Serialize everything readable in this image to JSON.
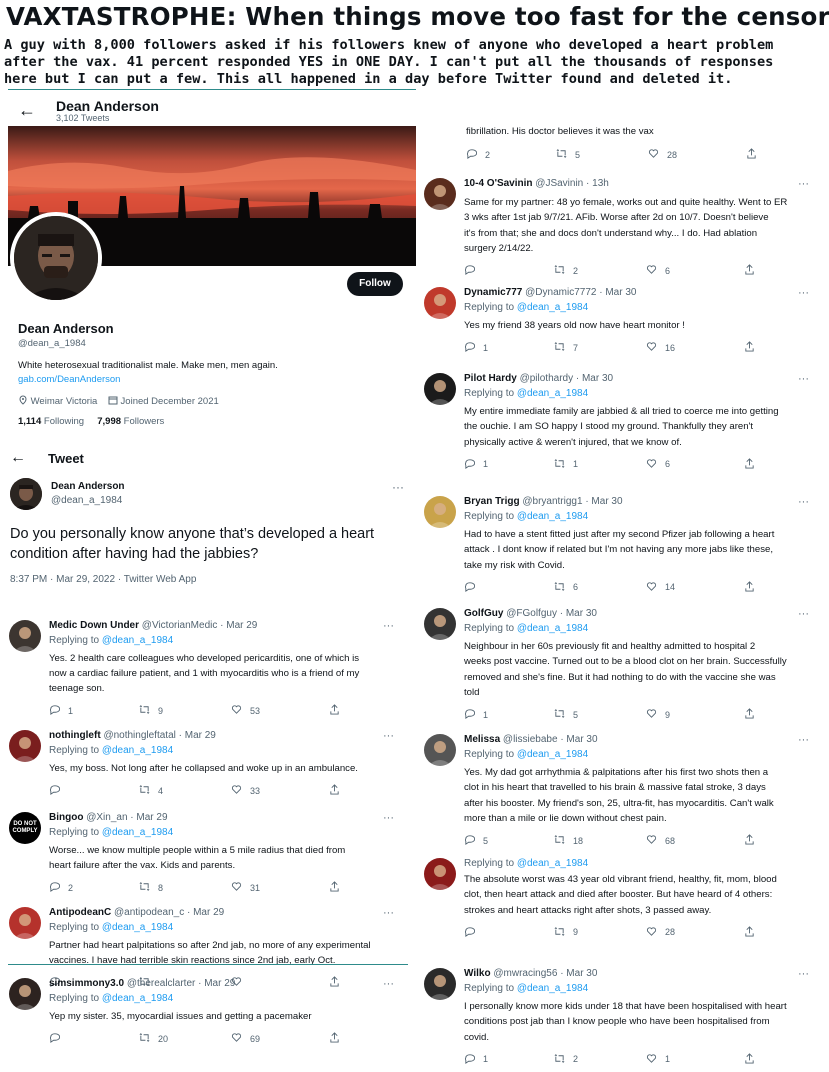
{
  "headline": "VAXTASTROPHE:  When things move too fast for the censors.",
  "subhead": [
    "A guy with 8,000 followers asked if his followers knew of anyone who developed a heart problem",
    "after the vax.  41 percent responded YES in ONE DAY.  I can't put all the thousands of responses",
    "here but I can put a few. This all happened in a day before Twitter found and deleted it."
  ],
  "profile": {
    "name": "Dean Anderson",
    "tweets": "3,102 Tweets",
    "follow_label": "Follow",
    "handle": "@dean_a_1984",
    "bio": "White heterosexual traditionalist male. Make men, men again.",
    "link": "gab.com/DeanAnderson",
    "location": "Weimar Victoria",
    "joined": "Joined December 2021",
    "following_count": "1,114",
    "following_label": "Following",
    "followers_count": "7,998",
    "followers_label": "Followers"
  },
  "tweet": {
    "title": "Tweet",
    "name": "Dean Anderson",
    "handle": "@dean_a_1984",
    "text": "Do you personally know anyone that’s developed a heart condition after having had the jabbies?",
    "time": "8:37 PM · Mar 29, 2022 · Twitter Web App"
  },
  "replying_prefix": "Replying to",
  "reply_target": "@dean_a_1984",
  "left_replies": [
    {
      "name": "Medic Down Under",
      "sub": "@VictorianMedic · Mar 29",
      "lines": [
        "Yes. 2 health care colleagues who developed pericarditis, one of which is",
        "now a cardiac failure patient, and 1 with myocarditis who is a friend of my",
        "teenage son."
      ],
      "reply": "1",
      "retweet": "9",
      "like": "53"
    },
    {
      "name": "nothingleft",
      "sub": "@nothingleftatal · Mar 29",
      "lines": [
        "Yes, my boss. Not long after he collapsed and woke up in an ambulance."
      ],
      "reply": "",
      "retweet": "4",
      "like": "33"
    },
    {
      "name": "Bingoo",
      "sub": "@Xin_an · Mar 29",
      "avatar_text": "DO NOT COMPLY",
      "lines": [
        "Worse... we know multiple people within a 5 mile radius that died from",
        "heart failure after the vax.  Kids and parents."
      ],
      "reply": "2",
      "retweet": "8",
      "like": "31"
    },
    {
      "name": "AntipodeanC",
      "sub": "@antipodean_c · Mar 29",
      "lines": [
        "Partner had heart palpitations so after 2nd jab, no more of any experimental",
        "vaccines. I have had terrible skin reactions since 2nd jab, early Oct."
      ],
      "reply": "",
      "retweet": "",
      "like": ""
    },
    {
      "name": "simsimmony3.0",
      "sub": "@therealclarter · Mar 29",
      "lines": [
        "Yep my sister. 35, myocardial issues and getting a pacemaker"
      ],
      "reply": "",
      "retweet": "20",
      "like": "69"
    }
  ],
  "right_top": {
    "line": "fibrillation. His doctor believes it was the vax",
    "reply": "2",
    "retweet": "5",
    "like": "28"
  },
  "right_replies": [
    {
      "name": "10-4 O'Savinin",
      "sub": "@JSavinin · 13h",
      "no_replying": true,
      "lines": [
        "Same for my partner: 48 yo female, works out and quite healthy. Went to ER",
        "3 wks after 1st jab 9/7/21. AFib. Worse after 2d on 10/7. Doesn't believe",
        "it's from that; she and docs don't understand why... I do. Had ablation",
        "surgery 2/14/22."
      ],
      "reply": "",
      "retweet": "2",
      "like": "6"
    },
    {
      "name": "Dynamic777",
      "sub": "@Dynamic7772 · Mar 30",
      "lines": [
        "Yes my friend 38 years old now have heart monitor !"
      ],
      "reply": "1",
      "retweet": "7",
      "like": "16"
    },
    {
      "name": "Pilot Hardy",
      "sub": "@pilothardy · Mar 30",
      "lines": [
        "My entire immediate family are jabbied & all tried to coerce me into getting",
        "the ouchie. I am SO happy I stood my ground. Thankfully they aren't",
        "physically active & weren't injured, that we know of."
      ],
      "reply": "1",
      "retweet": "1",
      "like": "6"
    },
    {
      "name": "Bryan Trigg",
      "sub": "@bryantrigg1 · Mar 30",
      "lines": [
        "Had to have a stent fitted just after my second Pfizer jab following a heart",
        "attack . I dont know if related but I'm not having any more jabs like these,",
        "take my risk with Covid."
      ],
      "reply": "",
      "retweet": "6",
      "like": "14"
    },
    {
      "name": "GolfGuy",
      "sub": "@FGolfguy · Mar 30",
      "lines": [
        "Neighbour in her 60s previously fit and healthy admitted to hospital 2",
        "weeks post vaccine. Turned out to be a blood clot on her brain. Successfully",
        "removed and she's fine. But it had nothing to do with the vaccine she was",
        "told"
      ],
      "reply": "1",
      "retweet": "5",
      "like": "9"
    },
    {
      "name": "Melissa",
      "sub": "@lissiebabe · Mar 30",
      "lines": [
        "Yes. My dad got arrhythmia & palpitations after his first two shots then a",
        "clot in his heart that travelled to his brain & massive fatal stroke, 3 days",
        "after his booster. My friend's son, 25, ultra-fit, has myocarditis. Can't walk",
        "more than a mile or lie down without chest pain."
      ],
      "reply": "5",
      "retweet": "18",
      "like": "68"
    },
    {
      "name": "",
      "sub": "",
      "lines": [
        "The absolute worst was 43 year old vibrant friend, healthy, fit, mom, blood",
        "clot, then heart attack and died after booster. But have heard of 4 others:",
        "strokes and heart attacks right after shots, 3 passed away."
      ],
      "reply": "",
      "retweet": "9",
      "like": "28"
    },
    {
      "name": "Wilko",
      "sub": "@mwracing56 · Mar 30",
      "lines": [
        "I personally know more kids under 18 that have been hospitalised with heart",
        "conditions post jab than I know people who have been hospitalised from",
        "covid."
      ],
      "reply": "1",
      "retweet": "2",
      "like": "1"
    }
  ]
}
